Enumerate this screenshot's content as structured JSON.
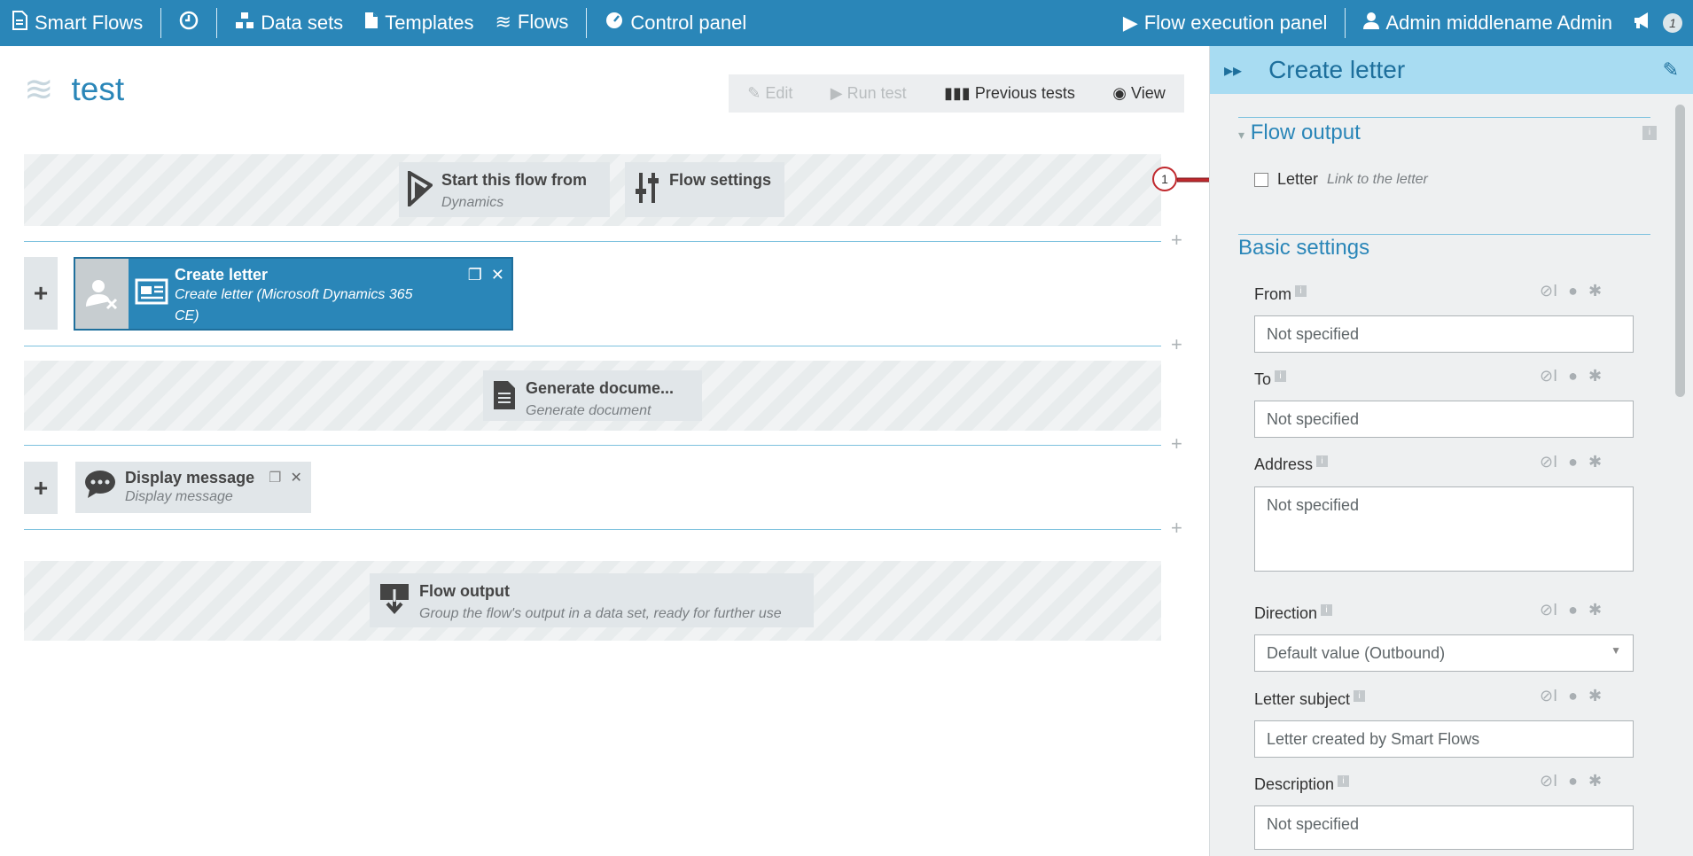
{
  "topbar": {
    "brand": "Smart Flows",
    "datasets": "Data sets",
    "templates": "Templates",
    "flows": "Flows",
    "control_panel": "Control panel",
    "execution_panel": "Flow execution panel",
    "user": "Admin middlename Admin",
    "notification_count": "1"
  },
  "page": {
    "title": "test",
    "toolbar": {
      "edit": "Edit",
      "run_test": "Run test",
      "previous_tests": "Previous tests",
      "view": "View"
    }
  },
  "flow": {
    "start": {
      "title": "Start this flow from",
      "subtitle": "Dynamics"
    },
    "settings": {
      "title": "Flow settings"
    },
    "create_letter": {
      "title": "Create letter",
      "subtitle": "Create letter (Microsoft Dynamics 365 CE)"
    },
    "generate": {
      "title": "Generate docume...",
      "subtitle": "Generate document"
    },
    "display": {
      "title": "Display message",
      "subtitle": "Display message"
    },
    "output": {
      "title": "Flow output",
      "subtitle": "Group the flow's output in a data set, ready for further use"
    }
  },
  "panel": {
    "title": "Create letter",
    "flow_output_section": "Flow output",
    "letter_label": "Letter",
    "letter_hint": "Link to the letter",
    "basic_settings": "Basic settings",
    "fields": {
      "from": {
        "label": "From",
        "value": "Not specified"
      },
      "to": {
        "label": "To",
        "value": "Not specified"
      },
      "address": {
        "label": "Address",
        "value": "Not specified"
      },
      "direction": {
        "label": "Direction",
        "value": "Default value (Outbound)"
      },
      "subject": {
        "label": "Letter subject",
        "value": "Letter created by Smart Flows"
      },
      "description": {
        "label": "Description",
        "value": "Not specified"
      }
    },
    "callout_number": "1"
  },
  "colors": {
    "brand": "#2a86b8",
    "panel_header": "#a8dcf2",
    "callout": "#c0282d"
  }
}
